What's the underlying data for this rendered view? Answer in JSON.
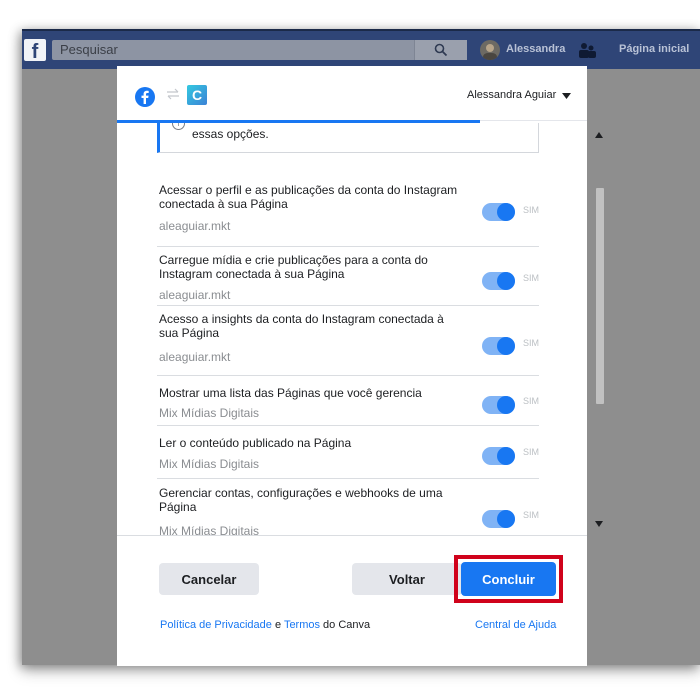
{
  "topbar": {
    "logo": "f",
    "search_placeholder": "Pesquisar",
    "user_name": "Alessandra",
    "home_label": "Página inicial"
  },
  "dialog": {
    "header": {
      "username": "Alessandra Aguiar",
      "canva_letter": "C"
    },
    "info_text": "essas opções.",
    "info_icon": "i",
    "toggle_label": "SIM",
    "permissions": [
      {
        "title": "Acessar o perfil e as publicações da conta do Instagram conectada à sua Página",
        "account": "aleaguiar.mkt",
        "enabled": true
      },
      {
        "title": "Carregue mídia e crie publicações para a conta do Instagram conectada à sua Página",
        "account": "aleaguiar.mkt",
        "enabled": true
      },
      {
        "title": "Acesso a insights da conta do Instagram conectada à sua Página",
        "account": "aleaguiar.mkt",
        "enabled": true
      },
      {
        "title": "Mostrar uma lista das Páginas que você gerencia",
        "account": "Mix Mídias Digitais",
        "enabled": true
      },
      {
        "title": "Ler o conteúdo publicado na Página",
        "account": "Mix Mídias Digitais",
        "enabled": true
      },
      {
        "title": "Gerenciar contas, configurações e webhooks de uma Página",
        "account": "Mix Mídias Digitais",
        "enabled": true
      }
    ],
    "buttons": {
      "cancel": "Cancelar",
      "back": "Voltar",
      "conclude": "Concluir"
    },
    "footer": {
      "privacy": "Política de Privacidade",
      "and": " e ",
      "terms": "Termos",
      "of_app": " do Canva",
      "help": "Central de Ajuda"
    }
  },
  "colors": {
    "facebook_blue": "#1877f2",
    "highlight_red": "#d0021b",
    "topbar": "#2f4577"
  }
}
